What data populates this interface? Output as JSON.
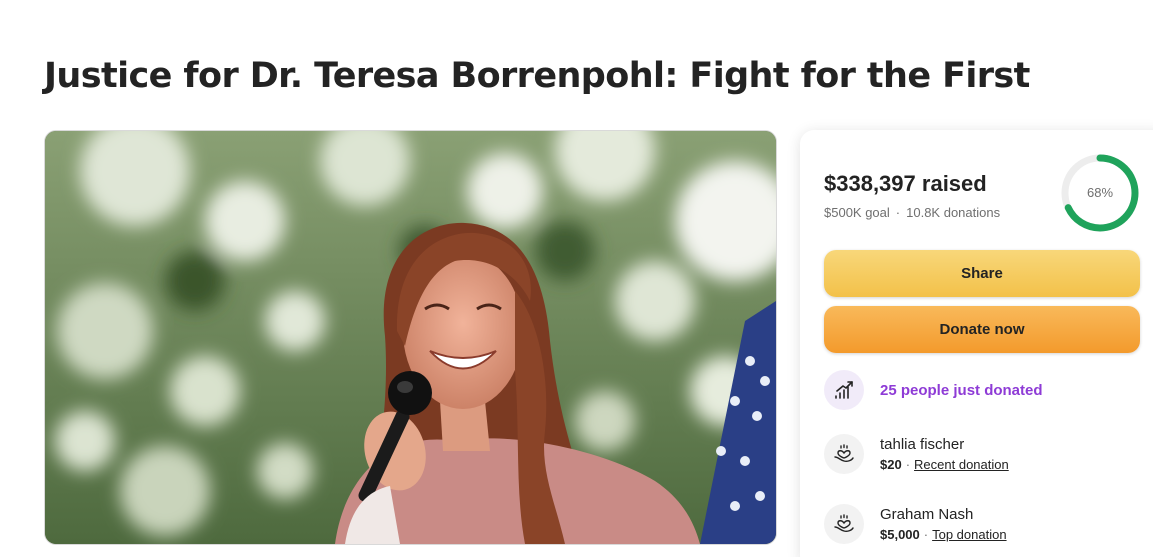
{
  "campaign": {
    "title": "Justice for Dr. Teresa Borrenpohl: Fight for the First"
  },
  "stats": {
    "raised_amount": "$338,397",
    "raised_suffix": "raised",
    "goal": "$500K goal",
    "donations": "10.8K donations",
    "progress_label": "68%",
    "progress_fraction": 0.68,
    "progress_color": "#1fa35b"
  },
  "actions": {
    "share_label": "Share",
    "donate_label": "Donate now"
  },
  "recent": {
    "just_donated_label": "25 people just donated",
    "accent_color": "#8e3bd6"
  },
  "donors": [
    {
      "name": "tahlia fischer",
      "amount": "$20",
      "tag": "Recent donation",
      "icon": "heart-hand-icon"
    },
    {
      "name": "Graham Nash",
      "amount": "$5,000",
      "tag": "Top donation",
      "icon": "heart-hand-icon"
    }
  ]
}
